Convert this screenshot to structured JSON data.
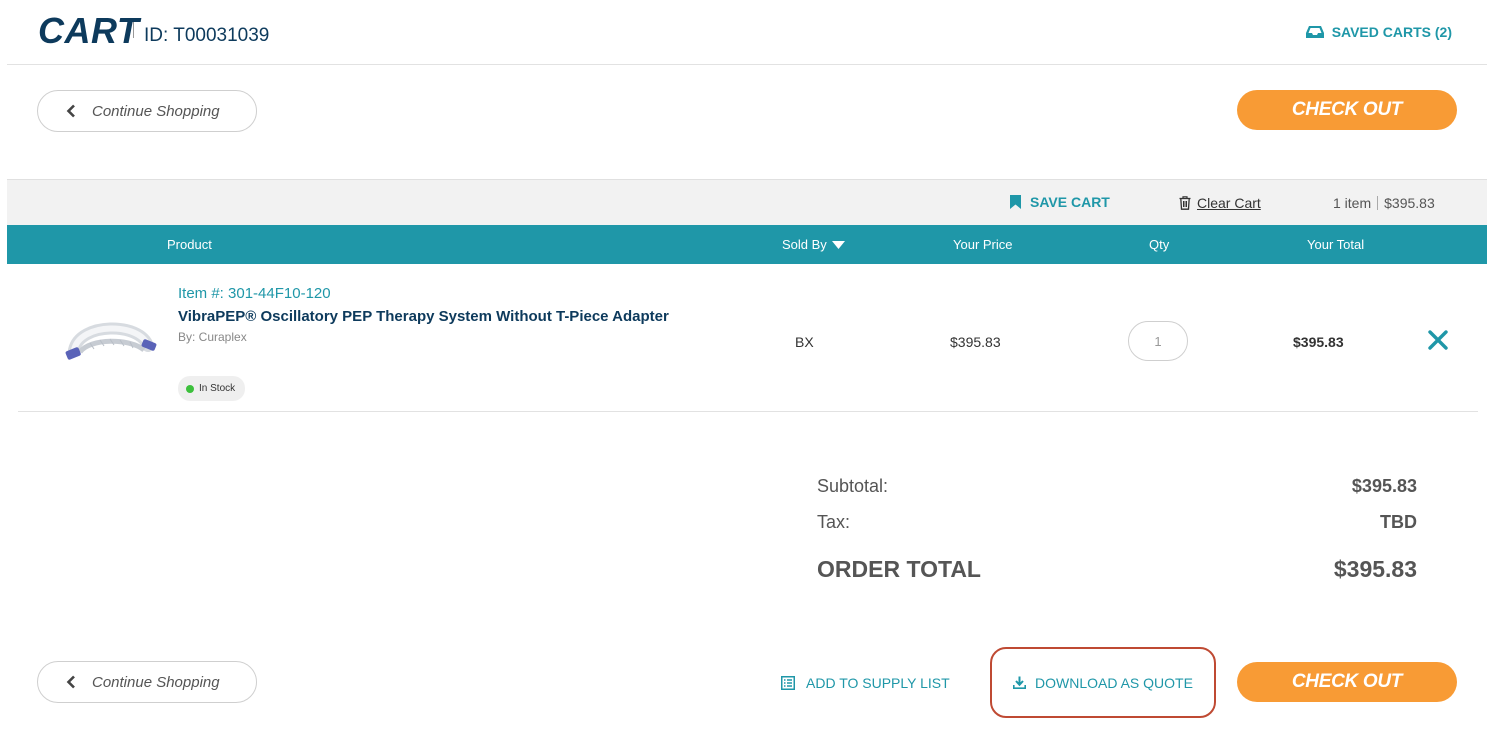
{
  "header": {
    "title": "CART",
    "cart_id": "ID: T00031039",
    "saved_carts": "SAVED CARTS (2)"
  },
  "actions": {
    "continue_shopping": "Continue Shopping",
    "check_out": "CHECK OUT"
  },
  "toolbar": {
    "save_cart": "SAVE CART",
    "clear_cart": "Clear Cart",
    "item_count": "1 item",
    "total": "$395.83"
  },
  "table": {
    "headers": {
      "product": "Product",
      "sold_by": "Sold By",
      "your_price": "Your Price",
      "qty": "Qty",
      "your_total": "Your Total"
    },
    "rows": [
      {
        "item_number": "Item #: 301-44F10-120",
        "name": "VibraPEP® Oscillatory PEP Therapy System Without T-Piece Adapter",
        "by": "By: Curaplex",
        "stock": "In Stock",
        "sold_by": "BX",
        "price": "$395.83",
        "qty": "1",
        "total": "$395.83"
      }
    ]
  },
  "summary": {
    "subtotal_label": "Subtotal:",
    "subtotal_value": "$395.83",
    "tax_label": "Tax:",
    "tax_value": "TBD",
    "order_total_label": "ORDER TOTAL",
    "order_total_value": "$395.83"
  },
  "footer": {
    "add_to_supply_list": "ADD TO SUPPLY LIST",
    "download_as_quote": "DOWNLOAD AS QUOTE"
  },
  "colors": {
    "brand_navy": "#0d3a5c",
    "accent_teal": "#1f97a8",
    "checkout_orange": "#f89b35",
    "in_stock_green": "#3cc03c",
    "highlight_border": "#bf4a33"
  }
}
